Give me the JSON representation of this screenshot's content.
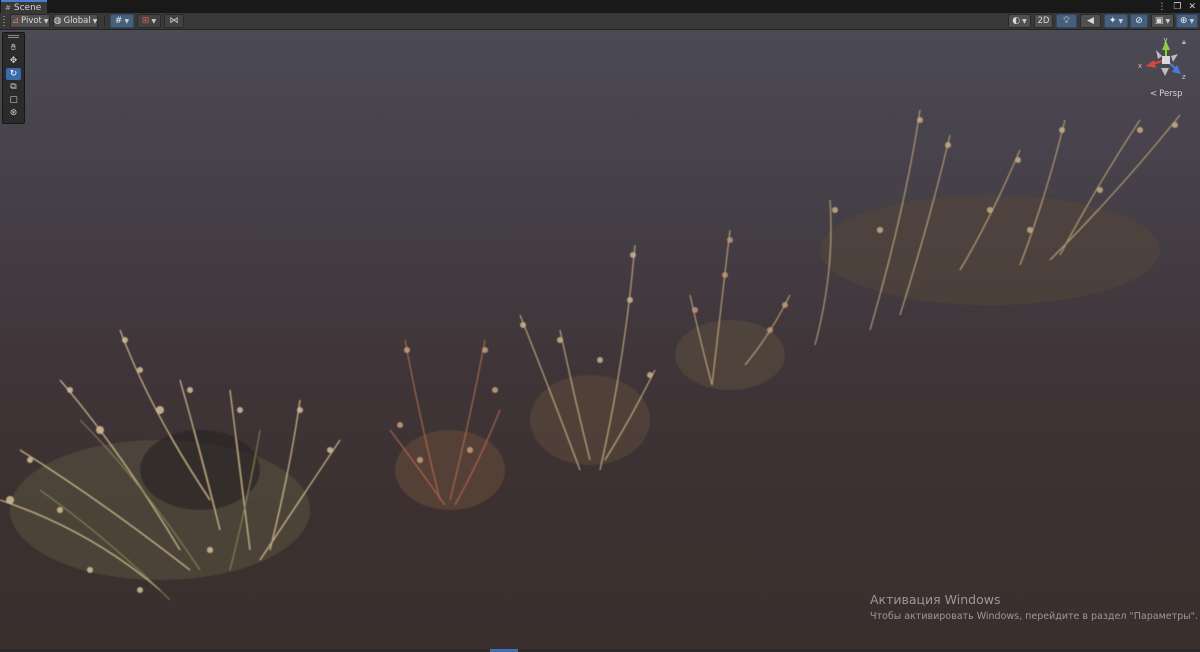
{
  "window": {
    "tab_label": "Scene"
  },
  "toolbar": {
    "pivot_label": "Pivot",
    "global_label": "Global",
    "mode_2d_label": "2D"
  },
  "gizmo": {
    "y_label": "y",
    "x_label": "x",
    "z_label": "z",
    "projection_label": "Persp",
    "colors": {
      "x": "#d24a3a",
      "y": "#8ccf3f",
      "z": "#4a79d9",
      "center": "#d9d9d9"
    }
  },
  "tools": [
    {
      "name": "view-tool",
      "icon": "hand-icon",
      "active": false
    },
    {
      "name": "move-tool",
      "icon": "move-arrows-icon",
      "active": false
    },
    {
      "name": "rotate-tool",
      "icon": "rotate-icon",
      "active": true
    },
    {
      "name": "scale-tool",
      "icon": "scale-icon",
      "active": false
    },
    {
      "name": "rect-tool",
      "icon": "rect-icon",
      "active": false
    },
    {
      "name": "transform-tool",
      "icon": "transform-icon",
      "active": false
    }
  ],
  "watermark": {
    "title": "Активация Windows",
    "subtitle": "Чтобы активировать Windows, перейдите в раздел \"Параметры\"."
  },
  "colors": {
    "accent": "#3b6aa8",
    "sky_top": "#4c4a55",
    "ground": "#3a2f2d",
    "grass_light": "#c4ab82",
    "grass_green": "#7a7a4a",
    "grass_red": "#9a5a46"
  }
}
